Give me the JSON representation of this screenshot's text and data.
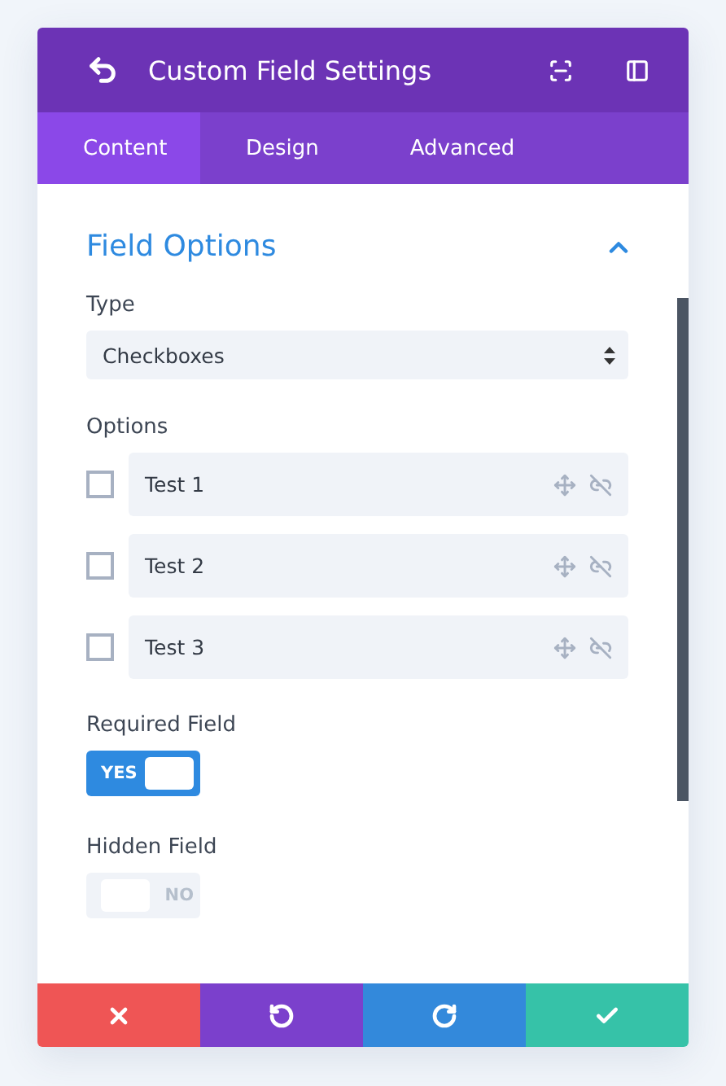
{
  "header": {
    "title": "Custom Field Settings"
  },
  "tabs": [
    {
      "label": "Content",
      "selected": true
    },
    {
      "label": "Design",
      "selected": false
    },
    {
      "label": "Advanced",
      "selected": false
    }
  ],
  "section": {
    "title": "Field Options",
    "expanded": true
  },
  "type_field": {
    "label": "Type",
    "value": "Checkboxes"
  },
  "options": {
    "label": "Options",
    "items": [
      {
        "label": "Test 1",
        "checked": false
      },
      {
        "label": "Test 2",
        "checked": false
      },
      {
        "label": "Test 3",
        "checked": false
      }
    ]
  },
  "toggles": [
    {
      "label": "Required Field",
      "on": true,
      "text": "YES"
    },
    {
      "label": "Hidden Field",
      "on": false,
      "text": "NO"
    }
  ],
  "footer": [
    {
      "kind": "cancel"
    },
    {
      "kind": "undo"
    },
    {
      "kind": "redo"
    },
    {
      "kind": "save"
    }
  ]
}
